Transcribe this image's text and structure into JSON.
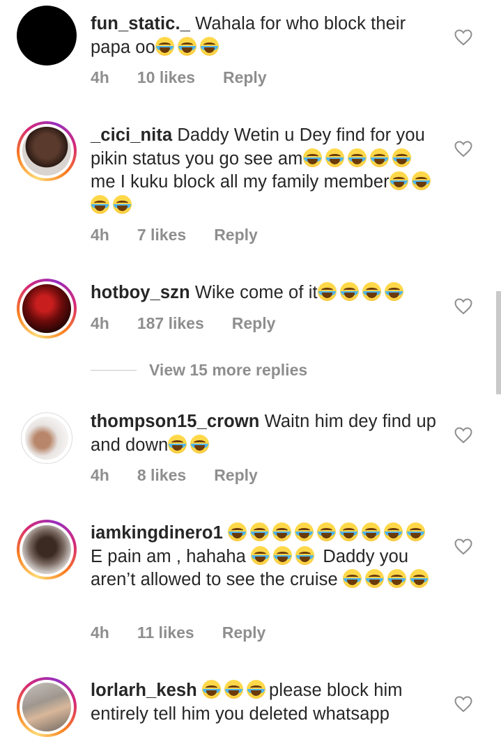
{
  "comments": [
    {
      "username": "fun_static._",
      "text": "Wahala for who block their papa oo",
      "emoji_count": 3,
      "time": "4h",
      "likes": "10 likes",
      "reply": "Reply"
    },
    {
      "username": "_cici_nita",
      "text_1": "Daddy Wetin u Dey find for you pikin status you go see am",
      "text_2": "me I kuku block all my family member",
      "time": "4h",
      "likes": "7 likes",
      "reply": "Reply"
    },
    {
      "username": "hotboy_szn",
      "text": "Wike come of it",
      "time": "4h",
      "likes": "187 likes",
      "reply": "Reply"
    },
    {
      "username": "thompson15_crown",
      "text": "Waitn him dey find up and down",
      "time": "4h",
      "likes": "8 likes",
      "reply": "Reply"
    },
    {
      "username": "iamkingdinero1",
      "text_1": "E pain am , hahaha",
      "text_2": "Daddy you aren’t allowed to see the cruise",
      "time": "4h",
      "likes": "11 likes",
      "reply": "Reply"
    },
    {
      "username": "lorlarh_kesh",
      "text": "please block him entirely tell him you deleted whatsapp"
    }
  ],
  "view_more_replies": "View 15 more replies",
  "icons": {
    "like": "heart-outline-icon",
    "emoji": "face-with-tears-of-joy"
  },
  "colors": {
    "text": "#262626",
    "meta": "#8e8e8e",
    "story_ring": "#d62976"
  }
}
